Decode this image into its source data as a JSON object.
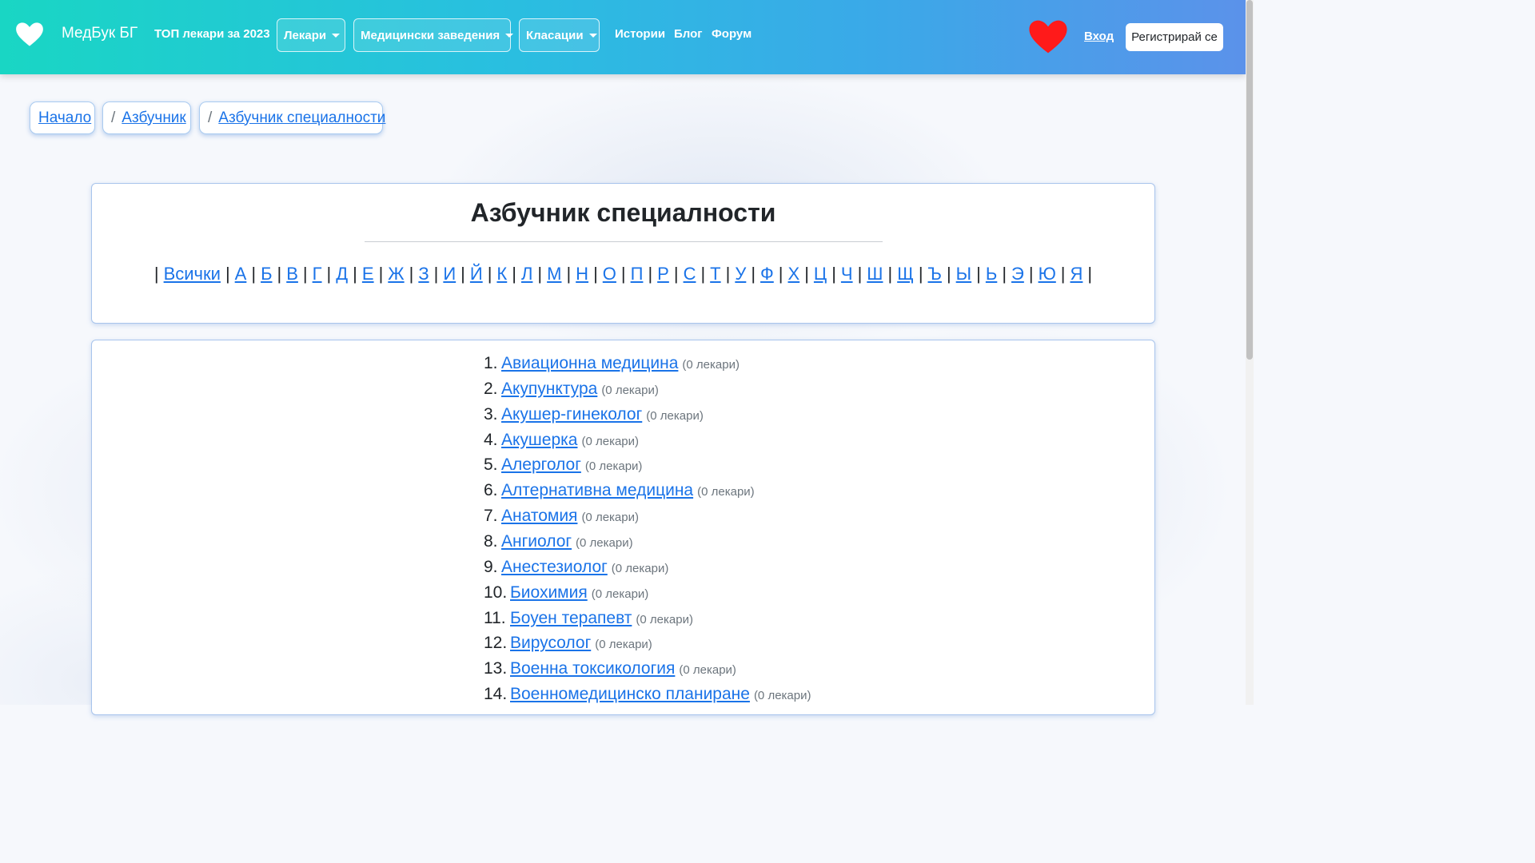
{
  "header": {
    "brand": "МедБук БГ",
    "top_doctors": "ТОП лекари за 2023",
    "dropdowns": [
      "Лекари",
      "Медицински заведения",
      "Класации"
    ],
    "links": [
      "Истории",
      "Блог",
      "Форум"
    ],
    "login": "Вход",
    "register": "Регистрирай се"
  },
  "breadcrumb": {
    "home": "Начало",
    "alphabet": "Азбучник",
    "current": "Азбучник специалности",
    "separator": "/"
  },
  "alphabet_card": {
    "title": "Азбучник специалности",
    "letters": [
      "Всички",
      "А",
      "Б",
      "В",
      "Г",
      "Д",
      "Е",
      "Ж",
      "З",
      "И",
      "Й",
      "К",
      "Л",
      "М",
      "Н",
      "О",
      "П",
      "Р",
      "С",
      "Т",
      "У",
      "Ф",
      "Х",
      "Ц",
      "Ч",
      "Ш",
      "Щ",
      "Ъ",
      "Ы",
      "Ь",
      "Э",
      "Ю",
      "Я"
    ]
  },
  "specialties": [
    {
      "num": "1.",
      "name": "Авиационна медицина",
      "count": "(0 лекари)"
    },
    {
      "num": "2.",
      "name": "Акупунктура",
      "count": "(0 лекари)"
    },
    {
      "num": "3.",
      "name": "Акушер-гинеколог",
      "count": "(0 лекари)"
    },
    {
      "num": "4.",
      "name": "Акушерка",
      "count": "(0 лекари)"
    },
    {
      "num": "5.",
      "name": "Алерголог",
      "count": "(0 лекари)"
    },
    {
      "num": "6.",
      "name": "Алтернативна медицина",
      "count": "(0 лекари)"
    },
    {
      "num": "7.",
      "name": "Анатомия",
      "count": "(0 лекари)"
    },
    {
      "num": "8.",
      "name": "Ангиолог",
      "count": "(0 лекари)"
    },
    {
      "num": "9.",
      "name": "Анестезиолог",
      "count": "(0 лекари)"
    },
    {
      "num": "10.",
      "name": "Биохимия",
      "count": "(0 лекари)"
    },
    {
      "num": "11.",
      "name": "Боуен терапевт",
      "count": "(0 лекари)"
    },
    {
      "num": "12.",
      "name": "Вирусолог",
      "count": "(0 лекари)"
    },
    {
      "num": "13.",
      "name": "Военна токсикология",
      "count": "(0 лекари)"
    },
    {
      "num": "14.",
      "name": "Военномедицинско планиране",
      "count": "(0 лекари)"
    }
  ]
}
